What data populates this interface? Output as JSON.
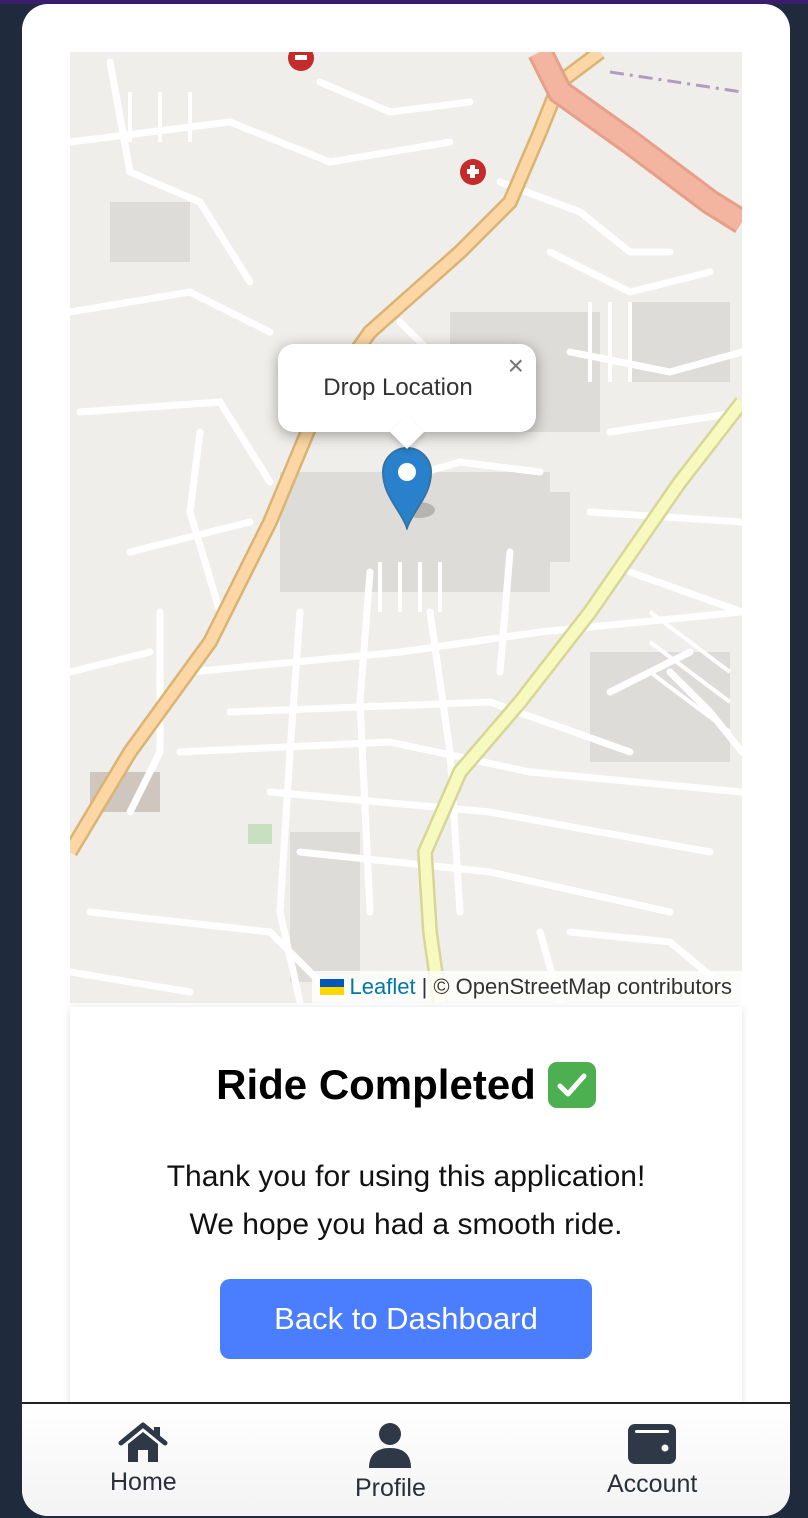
{
  "map": {
    "popup_text": "Drop Location",
    "popup_close": "×",
    "attribution": {
      "leaflet": "Leaflet",
      "separator": "|",
      "osm": "© OpenStreetMap contributors"
    }
  },
  "card": {
    "title": "Ride Completed",
    "check_icon": "check-mark-button-icon",
    "message_line1": "Thank you for using this application!",
    "message_line2": "We hope you had a smooth ride.",
    "button_label": "Back to Dashboard"
  },
  "nav": [
    {
      "label": "Home",
      "icon": "home-icon"
    },
    {
      "label": "Profile",
      "icon": "user-icon"
    },
    {
      "label": "Account",
      "icon": "wallet-icon"
    }
  ],
  "colors": {
    "primary_button": "#4a7eff",
    "map_background": "#f0eeea",
    "marker": "#2a81cb",
    "check": "#4caf50"
  }
}
